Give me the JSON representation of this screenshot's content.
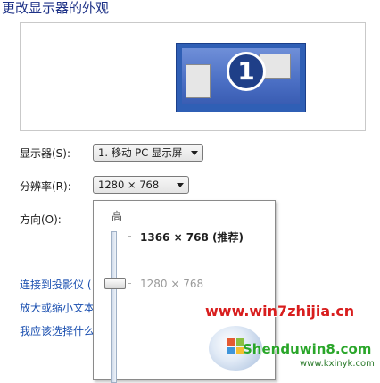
{
  "page": {
    "title": "更改显示器的外观"
  },
  "preview": {
    "monitor_number": "1"
  },
  "display": {
    "label": "显示器(S):",
    "value": "1. 移动 PC 显示屏"
  },
  "resolution": {
    "label": "分辨率(R):",
    "value": "1280 × 768"
  },
  "orientation": {
    "label": "方向(O):"
  },
  "links": {
    "projector": "连接到投影仪 (",
    "text_size": "放大或缩小文本",
    "which_settings": "我应该选择什么"
  },
  "resolution_popup": {
    "high_label": "高",
    "options": [
      "1366 × 768 (推荐)",
      "1280 × 768"
    ],
    "slider_level": "1280 × 768"
  },
  "watermark": {
    "url": "www.win7zhijia.cn",
    "site": "Shenduwin8.com",
    "domain": "www.kxinyk.com"
  },
  "colors": {
    "title": "#1e3287",
    "link": "#1a4fb0",
    "monitor": "#2f5fb5",
    "watermark_red": "#d81e1e",
    "watermark_green": "#2aa62a"
  }
}
